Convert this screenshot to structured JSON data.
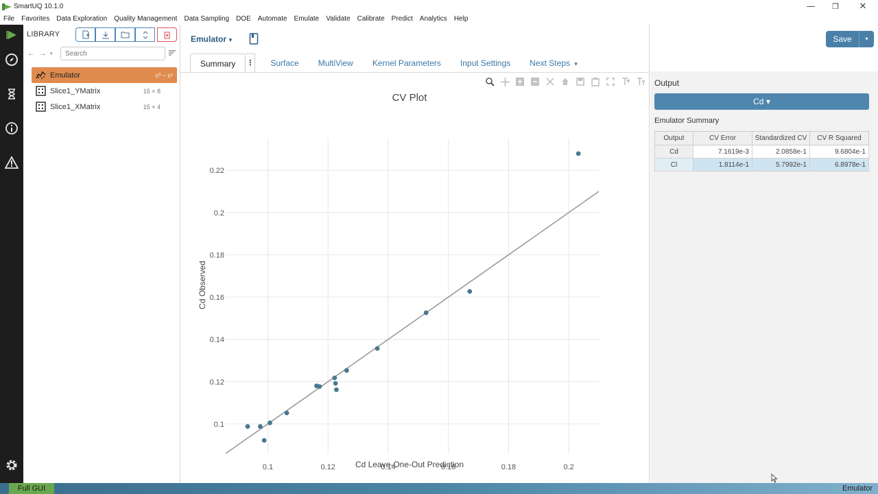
{
  "window": {
    "title": "SmartUQ 10.1.0",
    "minimize_glyph": "—",
    "restore_glyph": "❐",
    "close_glyph": "✕"
  },
  "menu": [
    "File",
    "Favorites",
    "Data Exploration",
    "Quality Management",
    "Data Sampling",
    "DOE",
    "Automate",
    "Emulate",
    "Validate",
    "Calibrate",
    "Predict",
    "Analytics",
    "Help"
  ],
  "activity_bar": [
    "play-icon",
    "compass-icon",
    "hourglass-icon",
    "info-icon",
    "warning-icon",
    "gear-icon"
  ],
  "library": {
    "heading": "LIBRARY",
    "tools": [
      "new-file-icon",
      "download-icon",
      "folder-icon",
      "sort-vertical-icon",
      "delete-icon"
    ],
    "search_placeholder": "Search",
    "items": [
      {
        "label": "Emulator",
        "meta": "c³ − c²",
        "icon": "emulator-icon",
        "selected": true
      },
      {
        "label": "Slice1_YMatrix",
        "meta": "15 × 8",
        "icon": "matrix-icon",
        "selected": false
      },
      {
        "label": "Slice1_XMatrix",
        "meta": "15 × 4",
        "icon": "matrix-icon",
        "selected": false
      }
    ]
  },
  "main": {
    "emulator_select": "Emulator",
    "tabs": [
      "Summary",
      "Surface",
      "MultiView",
      "Kernel Parameters",
      "Input Settings",
      "Next Steps"
    ],
    "active_tab": "Summary",
    "tab_more_glyph": "⋮",
    "next_steps_caret": "▾"
  },
  "save": {
    "label": "Save",
    "caret": "▾"
  },
  "output_panel": {
    "label": "Output",
    "output_select": "Cd ▾",
    "summary_heading": "Emulator Summary",
    "columns": [
      "Output",
      "CV Error",
      "Standardized CV",
      "CV R Squared"
    ],
    "rows": [
      {
        "name": "Cd",
        "values": [
          "7.1619e-3",
          "2.0858e-1",
          "9.6804e-1"
        ],
        "selected": false
      },
      {
        "name": "Cl",
        "values": [
          "1.8114e-1",
          "5.7992e-1",
          "6.8978e-1"
        ],
        "selected": true
      }
    ]
  },
  "chart_data": {
    "type": "scatter",
    "title": "CV Plot",
    "xlabel": "Cd Leave-One-Out Prediction",
    "ylabel": "Cd Observed",
    "xlim": [
      0.086,
      0.21
    ],
    "ylim": [
      0.086,
      0.235
    ],
    "xticks": [
      0.1,
      0.12,
      0.14,
      0.16,
      0.18,
      0.2
    ],
    "xtick_labels": [
      "0.1",
      "0.12",
      "0.14",
      "0.16",
      "0.18",
      "0.2"
    ],
    "yticks": [
      0.1,
      0.12,
      0.14,
      0.16,
      0.18,
      0.2,
      0.22
    ],
    "ytick_labels": [
      "0.1",
      "0.12",
      "0.14",
      "0.16",
      "0.18",
      "0.2",
      "0.22"
    ],
    "grid": true,
    "series": [
      {
        "x": [
          0.0933,
          0.0975,
          0.0988,
          0.1007,
          0.1063,
          0.1162,
          0.1172,
          0.1222,
          0.1225,
          0.1228,
          0.1262,
          0.1364,
          0.1526,
          0.1671,
          0.2032
        ],
        "y": [
          0.0988,
          0.0988,
          0.0922,
          0.1005,
          0.1052,
          0.118,
          0.1177,
          0.1218,
          0.1192,
          0.1162,
          0.1253,
          0.1357,
          0.1526,
          0.1627,
          0.2279
        ]
      }
    ],
    "reference_line": {
      "x": [
        0.086,
        0.21
      ],
      "y": [
        0.086,
        0.21
      ]
    },
    "point_color": "#4a7890",
    "line_color": "#9a9a9a"
  },
  "statusbar": {
    "left": "Full GUI",
    "right": "Emulator"
  }
}
